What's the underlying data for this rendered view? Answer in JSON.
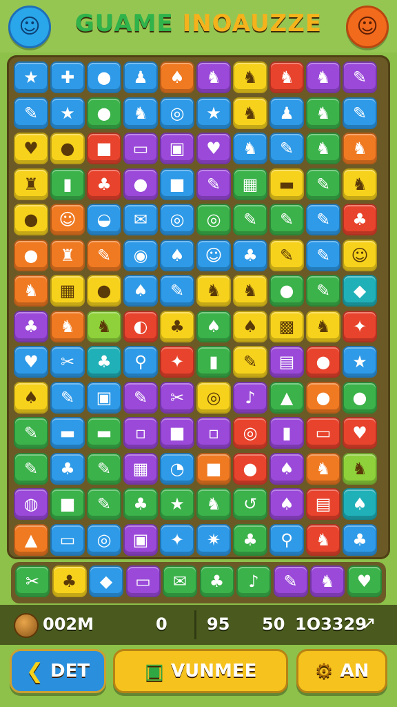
{
  "header": {
    "title_word1": "GUAME",
    "title_word2": "INOAUZZE",
    "left_icon": "blue-face-icon",
    "right_icon": "orange-face-icon",
    "left_glyph": "☺",
    "right_glyph": "☺"
  },
  "board": {
    "colors": {
      "blue": "#2e9ae8",
      "orange": "#f07a22",
      "yellow": "#f7d21c",
      "green": "#3bb24a",
      "purple": "#9a49d9",
      "red": "#e8432c",
      "lime": "#8ed13a",
      "teal": "#20b0b8"
    },
    "rows": [
      [
        "blue:★",
        "blue:✚",
        "blue:●",
        "blue:♟",
        "orange:♠",
        "purple:♞",
        "yellow:♞",
        "red:♞",
        "purple:♞",
        "purple:✎"
      ],
      [
        "blue:✎",
        "blue:★",
        "green:●",
        "blue:♞",
        "blue:◎",
        "blue:★",
        "yellow:♞",
        "blue:♟",
        "green:♞",
        "blue:✎"
      ],
      [
        "yellow:♥",
        "yellow:●",
        "red:■",
        "purple:▭",
        "purple:▣",
        "purple:♥",
        "blue:♞",
        "blue:✎",
        "green:♞",
        "orange:♞"
      ],
      [
        "yellow:♜",
        "green:▮",
        "red:♣",
        "purple:●",
        "blue:■",
        "purple:✎",
        "green:▦",
        "yellow:▬",
        "green:✎",
        "yellow:♞"
      ],
      [
        "yellow:●",
        "orange:☺",
        "blue:◒",
        "blue:✉",
        "blue:◎",
        "green:◎",
        "green:✎",
        "green:✎",
        "blue:✎",
        "red:♣"
      ],
      [
        "orange:●",
        "orange:♜",
        "orange:✎",
        "blue:◉",
        "blue:♠",
        "blue:☺",
        "blue:♣",
        "yellow:✎",
        "blue:✎",
        "yellow:☺"
      ],
      [
        "orange:♞",
        "yellow:▦",
        "yellow:●",
        "blue:♠",
        "blue:✎",
        "yellow:♞",
        "yellow:♞",
        "green:●",
        "green:✎",
        "teal:◆"
      ],
      [
        "purple:♣",
        "orange:♞",
        "lime:♞",
        "red:◐",
        "yellow:♣",
        "green:♠",
        "yellow:♠",
        "yellow:▩",
        "yellow:♞",
        "red:✦"
      ],
      [
        "blue:♥",
        "blue:✂",
        "teal:♣",
        "blue:⚲",
        "red:✦",
        "green:▮",
        "yellow:✎",
        "purple:▤",
        "red:●",
        "blue:★"
      ],
      [
        "yellow:♠",
        "blue:✎",
        "blue:▣",
        "purple:✎",
        "purple:✂",
        "yellow:◎",
        "purple:♪",
        "green:▲",
        "orange:●",
        "green:●"
      ],
      [
        "green:✎",
        "blue:▬",
        "green:▬",
        "purple:▫",
        "purple:■",
        "purple:▫",
        "red:◎",
        "purple:▮",
        "red:▭",
        "red:♥"
      ],
      [
        "green:✎",
        "blue:♣",
        "green:✎",
        "purple:▦",
        "blue:◔",
        "orange:■",
        "red:●",
        "purple:♠",
        "orange:♞",
        "lime:♞"
      ],
      [
        "purple:◍",
        "green:■",
        "green:✎",
        "green:♣",
        "green:★",
        "green:♞",
        "green:↺",
        "purple:♠",
        "red:▤",
        "teal:♠"
      ],
      [
        "orange:▲",
        "blue:▭",
        "blue:◎",
        "purple:▣",
        "blue:✦",
        "blue:✷",
        "green:♣",
        "blue:⚲",
        "red:♞",
        "blue:♣"
      ]
    ],
    "tray": [
      "green:✂",
      "yellow:♣",
      "blue:◆",
      "purple:▭",
      "green:✉",
      "green:♣",
      "green:♪",
      "purple:✎",
      "purple:♞",
      "green:♥"
    ]
  },
  "status": {
    "coin_icon": "coin-icon",
    "coins": "002M",
    "value1": "0",
    "value2": "95",
    "value3": "50",
    "score": "1O3329",
    "bolt_glyph": "↗"
  },
  "buttons": {
    "back_label": "DET",
    "back_icon_glyph": "❮",
    "main_label": "VUNMEE",
    "main_icon_glyph": "▣",
    "opt_label": "AN",
    "opt_icon_glyph": "⚙"
  }
}
